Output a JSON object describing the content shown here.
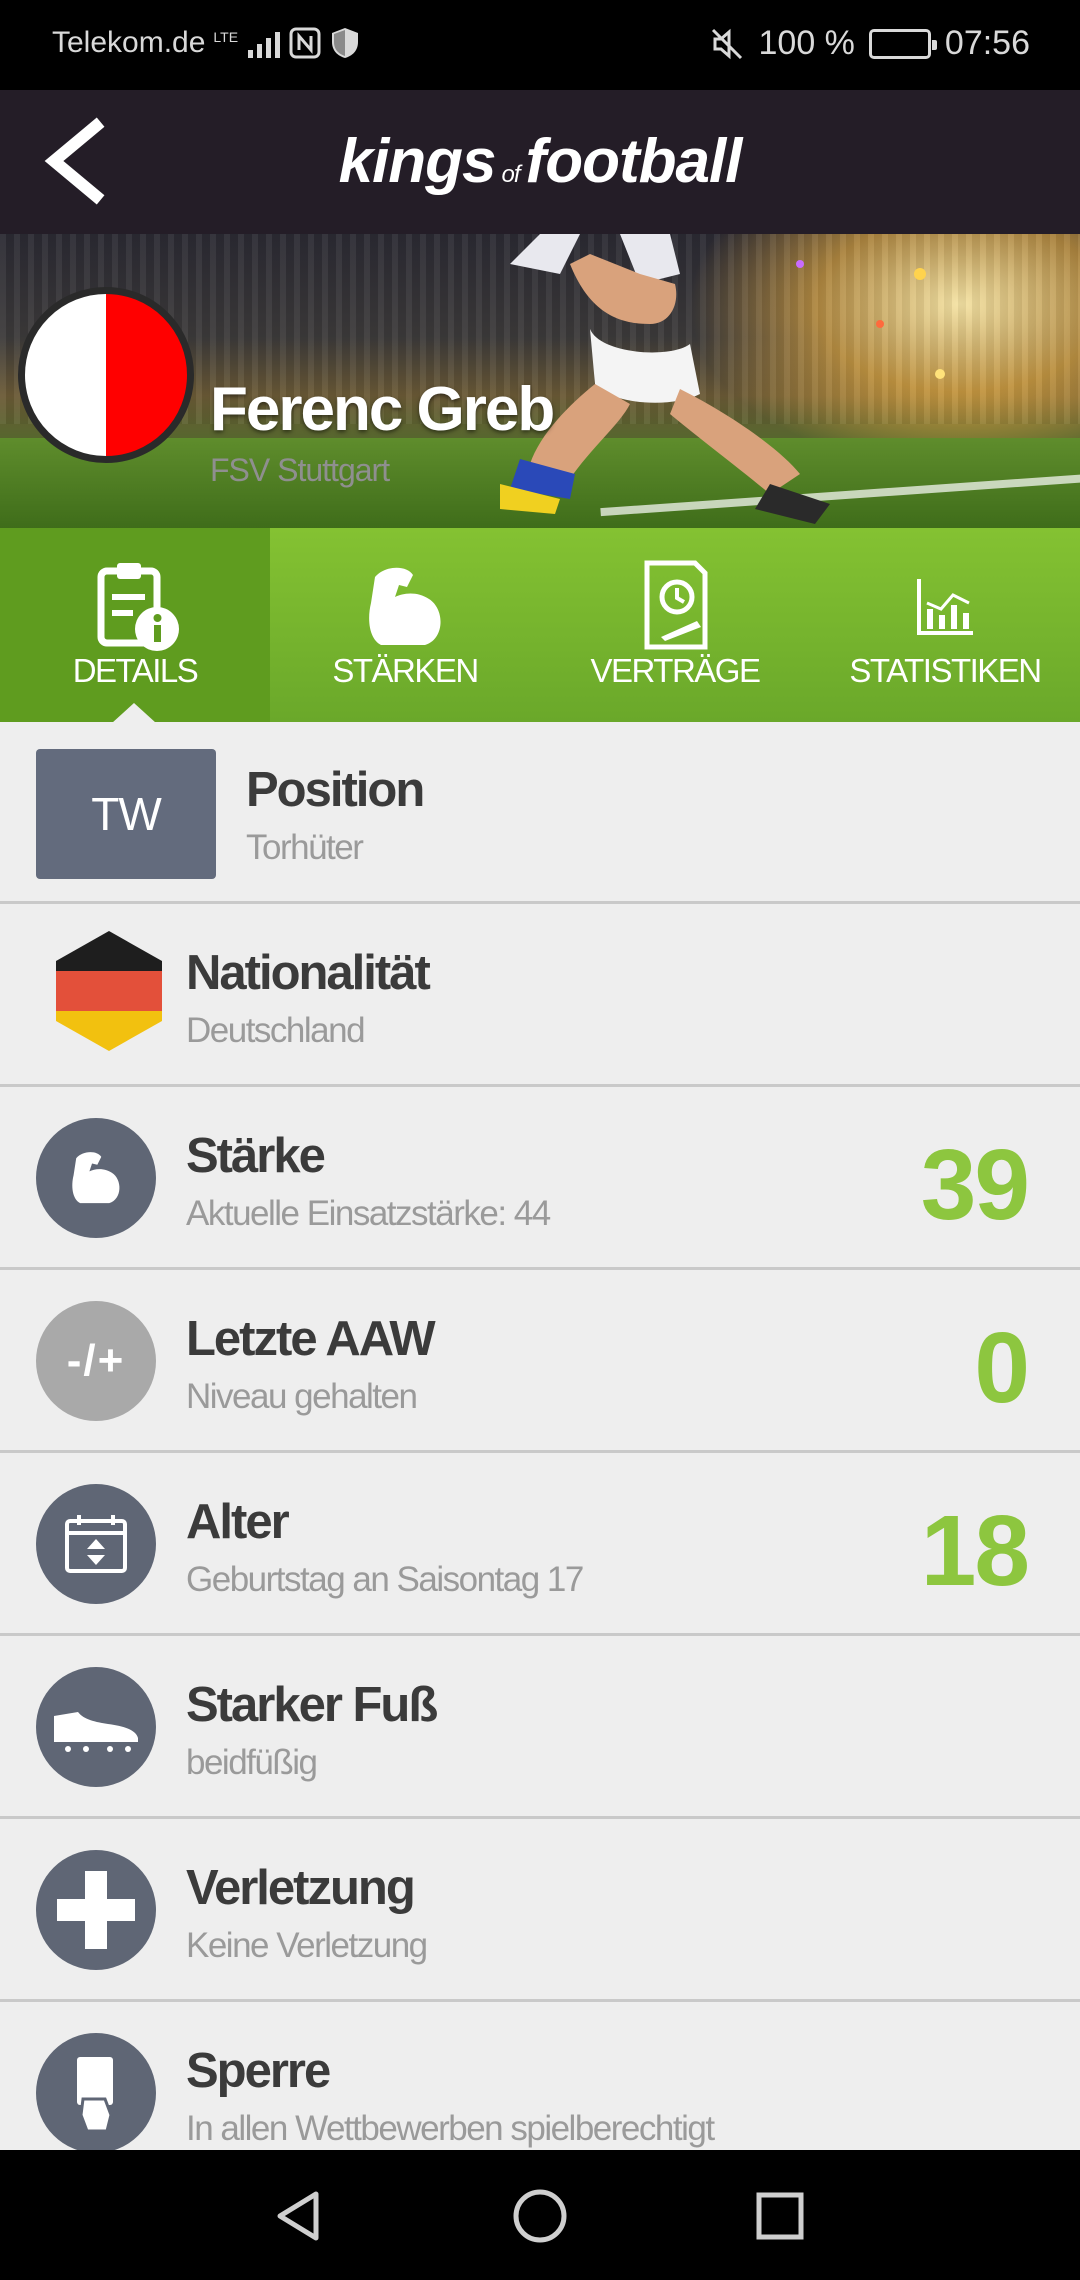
{
  "status_bar": {
    "carrier": "Telekom.de",
    "network": "LTE",
    "battery_percent": "100 %",
    "time": "07:56",
    "icons": [
      "signal-icon",
      "nfc-icon",
      "shield-icon",
      "mute-icon",
      "battery-icon"
    ]
  },
  "header": {
    "logo_left": "kings",
    "logo_of": "of",
    "logo_right": "football",
    "back_icon": "back-arrow-icon"
  },
  "player": {
    "name": "Ferenc Greb",
    "club": "FSV Stuttgart",
    "badge_colors": [
      "#ffffff",
      "#ff0000"
    ]
  },
  "tabs": [
    {
      "label": "DETAILS",
      "icon": "details-clipboard-icon",
      "active": true
    },
    {
      "label": "STÄRKEN",
      "icon": "bicep-icon",
      "active": false
    },
    {
      "label": "VERTRÄGE",
      "icon": "contract-icon",
      "active": false
    },
    {
      "label": "STATISTIKEN",
      "icon": "chart-icon",
      "active": false
    }
  ],
  "rows": [
    {
      "badge": "TW",
      "title": "Position",
      "subtitle": "Torhüter",
      "value": ""
    },
    {
      "icon": "germany-flag-icon",
      "title": "Nationalität",
      "subtitle": "Deutschland",
      "value": ""
    },
    {
      "icon": "bicep-icon",
      "title": "Stärke",
      "subtitle": "Aktuelle Einsatzstärke: 44",
      "value": "39"
    },
    {
      "icon_text": "-/+",
      "icon": "plus-minus-icon",
      "title": "Letzte AAW",
      "subtitle": "Niveau gehalten",
      "value": "0"
    },
    {
      "icon": "calendar-icon",
      "title": "Alter",
      "subtitle": "Geburtstag an Saisontag 17",
      "value": "18"
    },
    {
      "icon": "football-boot-icon",
      "title": "Starker Fuß",
      "subtitle": "beidfüßig",
      "value": ""
    },
    {
      "icon": "medical-cross-icon",
      "title": "Verletzung",
      "subtitle": "Keine Verletzung",
      "value": ""
    },
    {
      "icon": "red-card-hand-icon",
      "title": "Sperre",
      "subtitle": "In allen Wettbewerben spielberechtigt",
      "value": ""
    }
  ],
  "colors": {
    "accent_green": "#8dc63f",
    "tab_green": "#7ab52f",
    "header_dark": "#241d27",
    "icon_slate": "#5f6675"
  },
  "nav": [
    "back-triangle-icon",
    "home-circle-icon",
    "recents-square-icon"
  ]
}
